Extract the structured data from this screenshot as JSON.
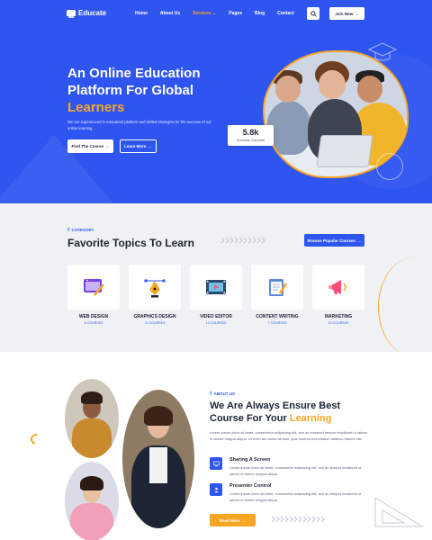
{
  "nav": {
    "brand": "Educate",
    "items": [
      {
        "label": "Home"
      },
      {
        "label": "About Us"
      },
      {
        "label": "Services ⌄"
      },
      {
        "label": "Pages"
      },
      {
        "label": "Blog"
      },
      {
        "label": "Contact"
      }
    ],
    "join_label": "Join Now",
    "active_color": "#f6a623"
  },
  "hero": {
    "title_line1": "An Online Education",
    "title_line2": "Platform For Global",
    "title_highlight": "Learners",
    "description": "We are experienced in educationl platform and skilled strategies for the success of our online learning.",
    "find_label": "Find The Course",
    "learn_label": "Learn More",
    "stat_value": "5.8k",
    "stat_label": "Success Courses",
    "background_color": "#2f55f0"
  },
  "category": {
    "eyebrow": "CATEGORY",
    "title": "Favorite Topics To Learn",
    "browse_label": "Browse Popular Courses",
    "cards": [
      {
        "name": "WEB DESIGN",
        "count": "8 COURSES",
        "icon": "web-design-icon"
      },
      {
        "name": "GRAPHICS DESIGN",
        "count": "10 COURSES",
        "icon": "pen-tool-icon"
      },
      {
        "name": "VIDEO EDITOR",
        "count": "13 COURSES",
        "icon": "film-icon"
      },
      {
        "name": "CONTENT WRITING",
        "count": "7 COURSES",
        "icon": "notepad-icon"
      },
      {
        "name": "MARKETING",
        "count": "10 COURSES",
        "icon": "megaphone-icon"
      }
    ]
  },
  "about": {
    "eyebrow": "ABOUT US",
    "title_line1": "We Are Always Ensure Best",
    "title_line2": "Course For Your",
    "title_highlight": "Learning",
    "description": "Lorem ipsum dolor sit amet, consectetur adipiscing elit, sed do eiusmod tempor incididunt ut labore et dolore magna aliqua. Ut enim ad minim veniam, quis nostrud exercitation ullamco laboris nisi.",
    "features": [
      {
        "title": "Sharing A Screen",
        "text": "Lorem ipsum dolor sit amet, consectetur adipiscing elit, sed do tempor incididunt ut labore et dolore magna aliqua.",
        "icon": "screen-icon"
      },
      {
        "title": "Presenter Control",
        "text": "Lorem ipsum dolor sit amet, consectetur adipiscing elit, sed do tempor incididunt ut labore et dolore magna aliqua.",
        "icon": "presenter-icon"
      }
    ],
    "readmore_label": "Read More"
  }
}
